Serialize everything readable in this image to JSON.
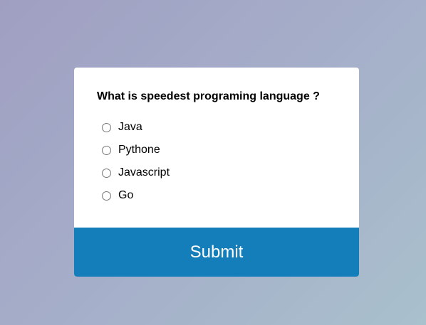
{
  "quiz": {
    "question": "What is speedest programing language ?",
    "answers": [
      {
        "label": "Java",
        "checked": false
      },
      {
        "label": "Pythone",
        "checked": false
      },
      {
        "label": "Javascript",
        "checked": false
      },
      {
        "label": "Go",
        "checked": false
      }
    ],
    "submit_label": "Submit"
  },
  "colors": {
    "accent": "#137eb9",
    "card_background": "#ffffff",
    "background_gradient": [
      "#a09fc2",
      "#a9c0cd"
    ]
  }
}
